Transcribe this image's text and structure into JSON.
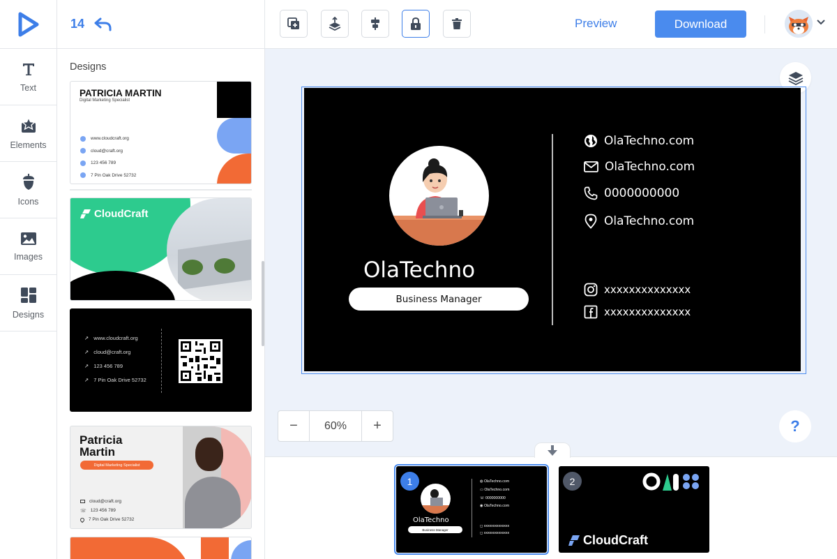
{
  "app": {
    "undo_count": "14"
  },
  "rail": [
    {
      "id": "text",
      "label": "Text"
    },
    {
      "id": "elements",
      "label": "Elements"
    },
    {
      "id": "icons",
      "label": "Icons"
    },
    {
      "id": "images",
      "label": "Images"
    },
    {
      "id": "designs",
      "label": "Designs"
    }
  ],
  "panel": {
    "title": "Designs",
    "templates": {
      "t1": {
        "name": "PATRICIA MARTIN",
        "role": "Digital Marketing Specialist",
        "lines": [
          "www.cloudcraft.org",
          "cloud@craft.org",
          "123 456 789",
          "7 Pin Oak Drive 52732"
        ]
      },
      "t2": {
        "brand": "CloudCraft"
      },
      "t3": {
        "lines": [
          "www.cloudcraft.org",
          "cloud@craft.org",
          "123 456 789",
          "7 Pin Oak Drive 52732"
        ]
      },
      "t4": {
        "name_line1": "Patricia",
        "name_line2": "Martin",
        "role": "Digital Marketing Specialist",
        "lines": [
          "cloud@craft.org",
          "123 456 789",
          "7 Pin Oak Drive 52732"
        ]
      }
    }
  },
  "toolbar": {
    "preview_label": "Preview",
    "download_label": "Download"
  },
  "card": {
    "name": "OlaTechno",
    "title": "Business Manager",
    "website": "OlaTechno.com",
    "email": "OlaTechno.com",
    "phone": "0000000000",
    "address": "OlaTechno.com",
    "instagram": "xxxxxxxxxxxxxx",
    "facebook": "xxxxxxxxxxxxxx"
  },
  "zoom": {
    "minus": "−",
    "value": "60%",
    "plus": "+"
  },
  "help_label": "?",
  "pages": [
    {
      "num": "1",
      "name": "OlaTechno",
      "title": "Business Manager",
      "website": "OlaTechno.com",
      "email": "OlaTechno.com",
      "phone": "0000000000",
      "address": "OlaTechno.com",
      "instagram": "xxxxxxxxxxxxxx",
      "facebook": "xxxxxxxxxxxxxx"
    },
    {
      "num": "2",
      "brand": "CloudCraft"
    }
  ],
  "colors": {
    "accent": "#3d7ee8",
    "button": "#4a8bee",
    "canvas_bg": "#edf2fa",
    "green": "#2dcb8e",
    "orange": "#f26a35",
    "card_bg": "#000000"
  }
}
